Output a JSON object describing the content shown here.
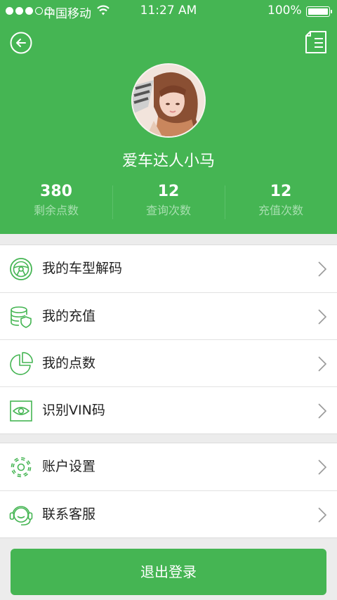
{
  "status_bar": {
    "carrier": "中国移动",
    "time": "11:27 AM",
    "battery": "100%"
  },
  "profile": {
    "username": "爱车达人小马",
    "stats": [
      {
        "value": "380",
        "label": "剩余点数"
      },
      {
        "value": "12",
        "label": "查询次数"
      },
      {
        "value": "12",
        "label": "充值次数"
      }
    ]
  },
  "menu": {
    "group1": [
      {
        "label": "我的车型解码",
        "icon": "steering-wheel-icon"
      },
      {
        "label": "我的充值",
        "icon": "coin-stack-icon"
      },
      {
        "label": "我的点数",
        "icon": "pie-chart-icon"
      },
      {
        "label": "识别VIN码",
        "icon": "eye-scan-icon"
      }
    ],
    "group2": [
      {
        "label": "账户设置",
        "icon": "gear-icon"
      },
      {
        "label": "联系客服",
        "icon": "headset-icon"
      }
    ]
  },
  "logout_label": "退出登录",
  "colors": {
    "brand_green": "#45b553",
    "page_bg": "#ececec"
  }
}
